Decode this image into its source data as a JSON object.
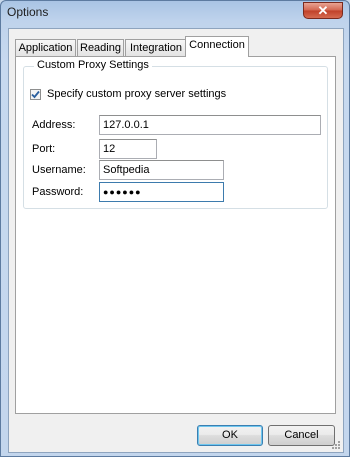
{
  "window": {
    "title": "Options",
    "close_glyph": "✕"
  },
  "tabs": [
    {
      "label": "Application",
      "active": false
    },
    {
      "label": "Reading",
      "active": false
    },
    {
      "label": "Integration",
      "active": false
    },
    {
      "label": "Connection",
      "active": true
    }
  ],
  "proxy": {
    "group_title": "Custom Proxy Settings",
    "checkbox_label": "Specify custom proxy server settings",
    "checkbox_checked": true,
    "address_label": "Address:",
    "address_value": "127.0.0.1",
    "port_label": "Port:",
    "port_value": "12",
    "username_label": "Username:",
    "username_value": "Softpedia",
    "password_label": "Password:",
    "password_value": "●●●●●●"
  },
  "buttons": {
    "ok": "OK",
    "cancel": "Cancel"
  },
  "icons": {
    "close": "close-icon",
    "checkmark": "checkmark-icon",
    "resize": "resize-grip-icon"
  }
}
